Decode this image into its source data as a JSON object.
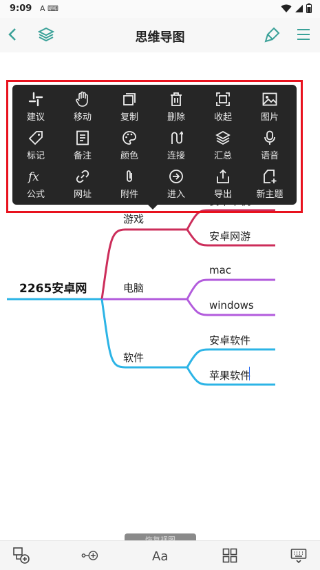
{
  "status": {
    "time": "9:09",
    "left_icons": "A ⌨"
  },
  "header": {
    "title": "思维导图"
  },
  "menu": {
    "items": [
      {
        "label": "建议",
        "icon": "slack-icon"
      },
      {
        "label": "移动",
        "icon": "hand-icon"
      },
      {
        "label": "复制",
        "icon": "copy-icon"
      },
      {
        "label": "删除",
        "icon": "trash-icon"
      },
      {
        "label": "收起",
        "icon": "collapse-icon"
      },
      {
        "label": "图片",
        "icon": "image-icon"
      },
      {
        "label": "标记",
        "icon": "tag-icon"
      },
      {
        "label": "备注",
        "icon": "note-icon"
      },
      {
        "label": "颜色",
        "icon": "palette-icon"
      },
      {
        "label": "连接",
        "icon": "connect-icon"
      },
      {
        "label": "汇总",
        "icon": "layers-icon"
      },
      {
        "label": "语音",
        "icon": "mic-icon"
      },
      {
        "label": "公式",
        "icon": "formula-icon"
      },
      {
        "label": "网址",
        "icon": "link-icon"
      },
      {
        "label": "附件",
        "icon": "paperclip-icon"
      },
      {
        "label": "进入",
        "icon": "enter-icon"
      },
      {
        "label": "导出",
        "icon": "export-icon"
      },
      {
        "label": "新主题",
        "icon": "new-topic-icon"
      }
    ]
  },
  "mindmap": {
    "root": "2265安卓网",
    "branches": [
      {
        "label": "游戏",
        "color": "#cc2d5a",
        "children": [
          "安卓单机",
          "安卓网游"
        ]
      },
      {
        "label": "电脑",
        "color": "#b25bdc",
        "children": [
          "mac",
          "windows"
        ]
      },
      {
        "label": "软件",
        "color": "#2cb4e6",
        "children": [
          "安卓软件",
          "苹果软件"
        ]
      }
    ]
  },
  "toast": {
    "text": "恢复视图"
  },
  "colors": {
    "accent": "#3aa198",
    "menu_bg": "#262626",
    "highlight": "#e8121e"
  }
}
